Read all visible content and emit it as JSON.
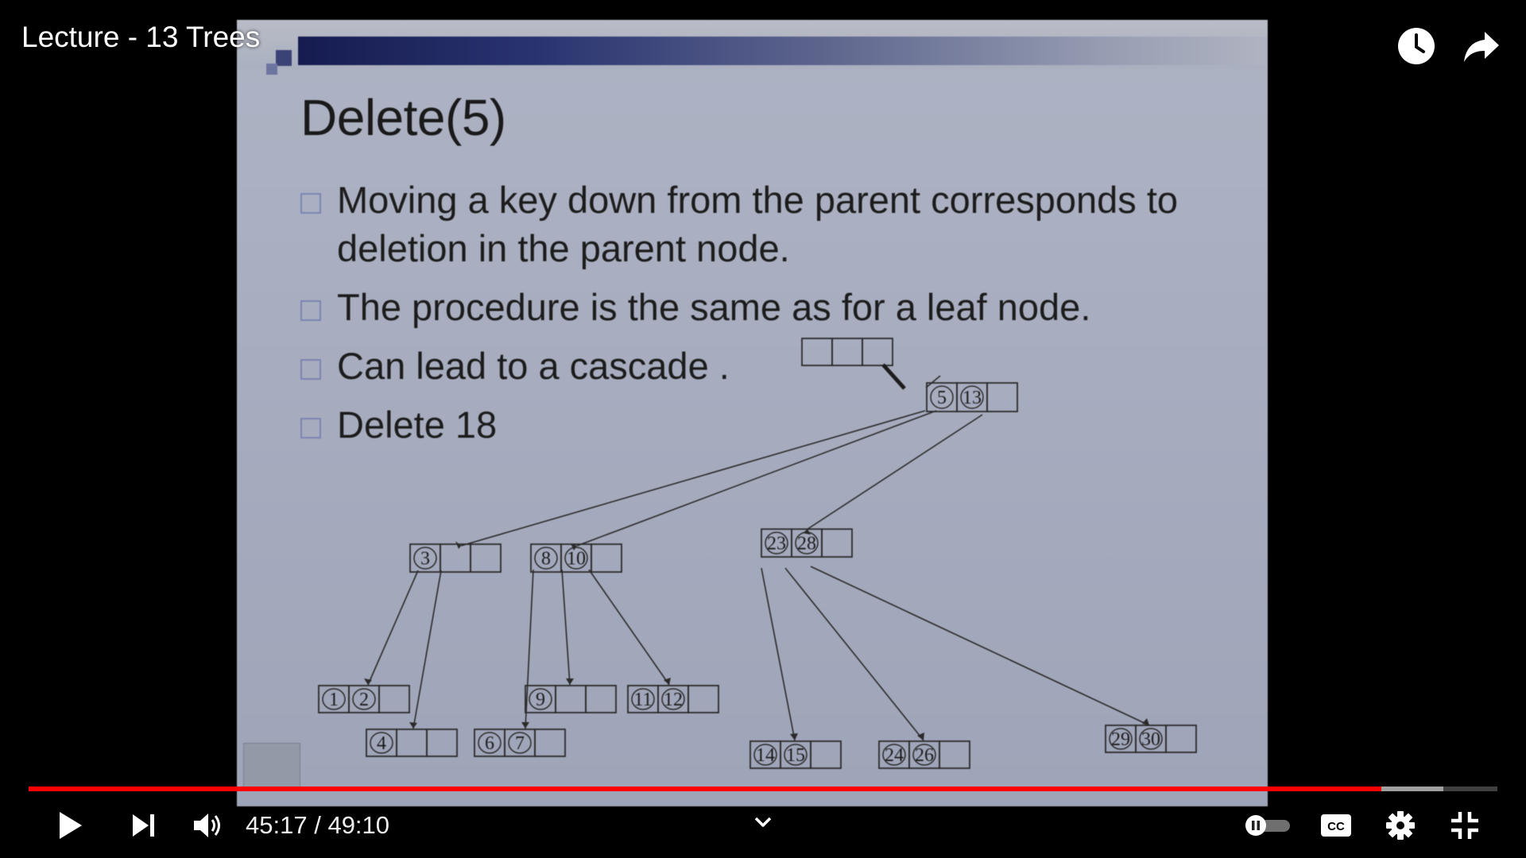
{
  "video": {
    "title": "Lecture - 13 Trees",
    "current_time": "45:17",
    "separator": "/",
    "duration": "49:10",
    "played_fraction": 0.921,
    "buffered_fraction": 0.963
  },
  "slide": {
    "title": "Delete(5)",
    "bullets": [
      "Moving a key down from the parent corresponds to deletion in the parent node.",
      "The procedure is the same as for a leaf node.",
      "Can lead to a cascade .",
      "Delete 18"
    ],
    "tree": {
      "detached": {
        "keys": [
          "",
          "",
          ""
        ]
      },
      "root": {
        "keys": [
          "5",
          "13",
          ""
        ]
      },
      "level1": [
        {
          "keys": [
            "3",
            "",
            ""
          ]
        },
        {
          "keys": [
            "8",
            "10",
            ""
          ]
        },
        {
          "keys": [
            "23",
            "28",
            ""
          ]
        }
      ],
      "leaves": [
        {
          "keys": [
            "1",
            "2",
            ""
          ]
        },
        {
          "keys": [
            "4",
            "",
            ""
          ]
        },
        {
          "keys": [
            "6",
            "7",
            ""
          ]
        },
        {
          "keys": [
            "9",
            "",
            ""
          ]
        },
        {
          "keys": [
            "11",
            "12",
            ""
          ]
        },
        {
          "keys": [
            "14",
            "15",
            ""
          ]
        },
        {
          "keys": [
            "24",
            "26",
            ""
          ]
        },
        {
          "keys": [
            "29",
            "30",
            ""
          ]
        }
      ]
    }
  },
  "colors": {
    "accent": "#ff0000",
    "background": "#000000"
  },
  "icons": {
    "watch_later": "clock-icon",
    "share": "share-icon",
    "play": "play-icon",
    "next": "next-icon",
    "volume": "volume-icon",
    "chapters": "chevron-down-icon",
    "autoplay": "autoplay-toggle",
    "captions": "captions-icon",
    "settings": "gear-icon",
    "exit_fullscreen": "exit-fullscreen-icon"
  }
}
